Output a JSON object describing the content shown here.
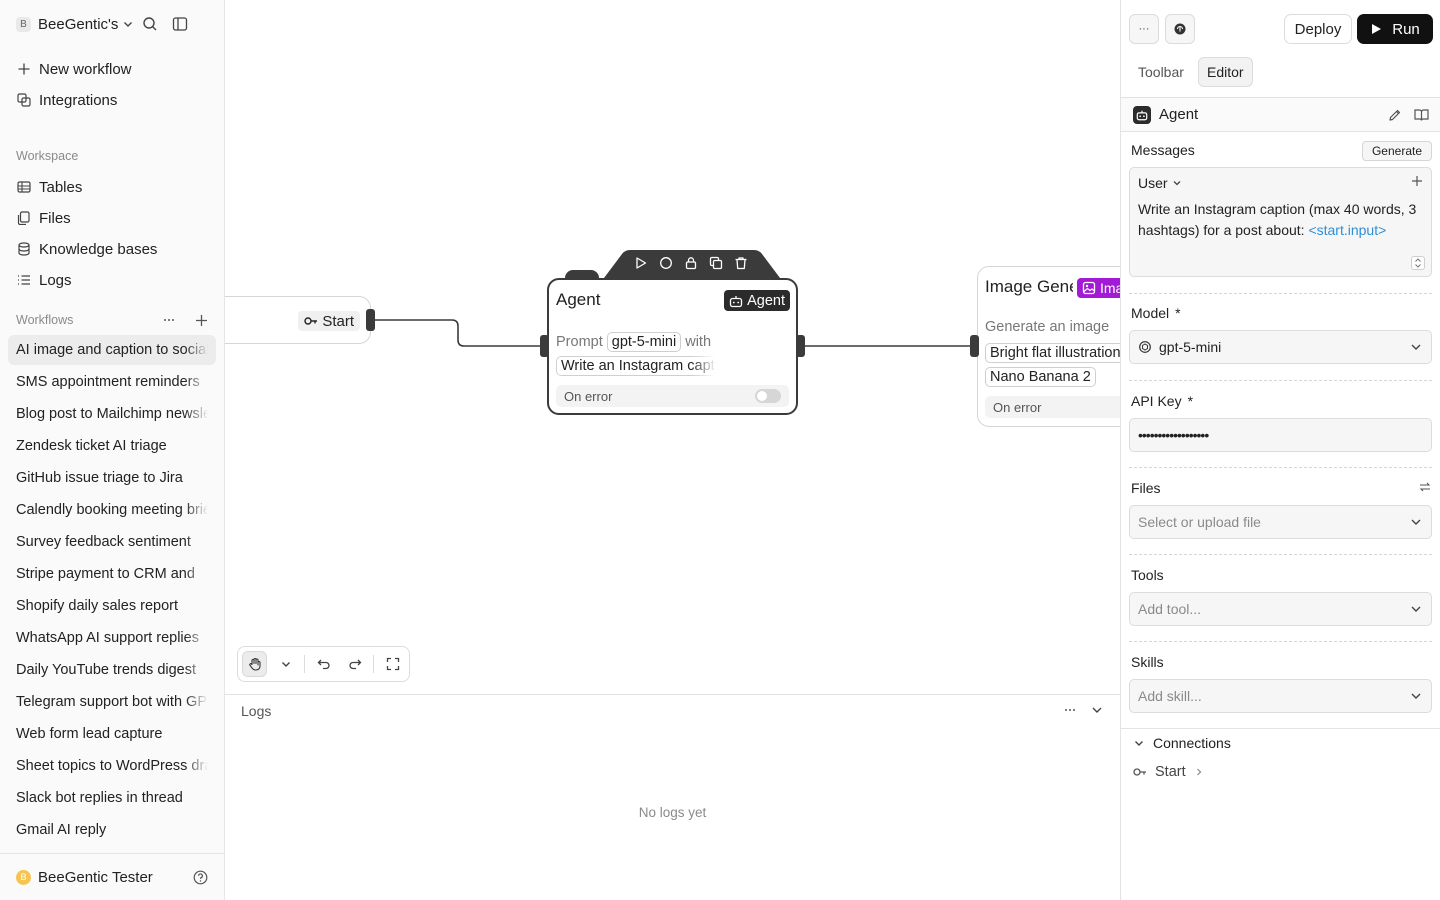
{
  "sidebar": {
    "workspace_initial": "B",
    "workspace_name": "BeeGentic's",
    "nav": [
      {
        "label": "New workflow",
        "icon": "plus-icon"
      },
      {
        "label": "Integrations",
        "icon": "integrations-icon"
      }
    ],
    "workspace_label": "Workspace",
    "workspace_items": [
      {
        "label": "Tables",
        "icon": "table-icon"
      },
      {
        "label": "Files",
        "icon": "files-icon"
      },
      {
        "label": "Knowledge bases",
        "icon": "database-icon"
      },
      {
        "label": "Logs",
        "icon": "list-icon"
      }
    ],
    "workflows_label": "Workflows",
    "workflows": [
      "AI image and caption to social",
      "SMS appointment reminders",
      "Blog post to Mailchimp newsletter",
      "Zendesk ticket AI triage",
      "GitHub issue triage to Jira",
      "Calendly booking meeting brief",
      "Survey feedback sentiment",
      "Stripe payment to CRM and",
      "Shopify daily sales report",
      "WhatsApp AI support replies",
      "Daily YouTube trends digest",
      "Telegram support bot with GPT",
      "Web form lead capture",
      "Sheet topics to WordPress drafts",
      "Slack bot replies in thread",
      "Gmail AI reply"
    ],
    "user_initial": "B",
    "user_name": "BeeGentic Tester"
  },
  "canvas": {
    "start_node": {
      "label": "Start"
    },
    "agent_node": {
      "title": "Agent",
      "badge": "Agent",
      "prompt_label": "Prompt",
      "model": "gpt-5-mini",
      "with_label": "with",
      "message_chip": "Write an Instagram caption",
      "on_error": "On error"
    },
    "image_node": {
      "title": "Image Generator",
      "badge": "Image",
      "prompt_label": "Generate an image",
      "prompt_chip": "Bright flat illustration",
      "model_chip": "Nano Banana 2",
      "on_error": "On error"
    }
  },
  "logs": {
    "title": "Logs",
    "empty": "No logs yet"
  },
  "panel": {
    "more_label": "···",
    "deploy": "Deploy",
    "run": "Run",
    "tabs": [
      "Toolbar",
      "Editor"
    ],
    "block_name": "Agent",
    "messages_label": "Messages",
    "generate": "Generate",
    "role": "User",
    "message_text": "Write an Instagram caption (max 40 words, 3 hashtags) for a post about: ",
    "message_ref": "<start.input>",
    "model_label": "Model",
    "model_value": "gpt-5-mini",
    "api_key_label": "API Key",
    "api_key_value": "••••••••••••••••••",
    "files_label": "Files",
    "files_placeholder": "Select or upload file",
    "tools_label": "Tools",
    "tools_placeholder": "Add tool...",
    "skills_label": "Skills",
    "skills_placeholder": "Add skill...",
    "required_mark": "*",
    "connections_label": "Connections",
    "connection_item": "Start"
  }
}
